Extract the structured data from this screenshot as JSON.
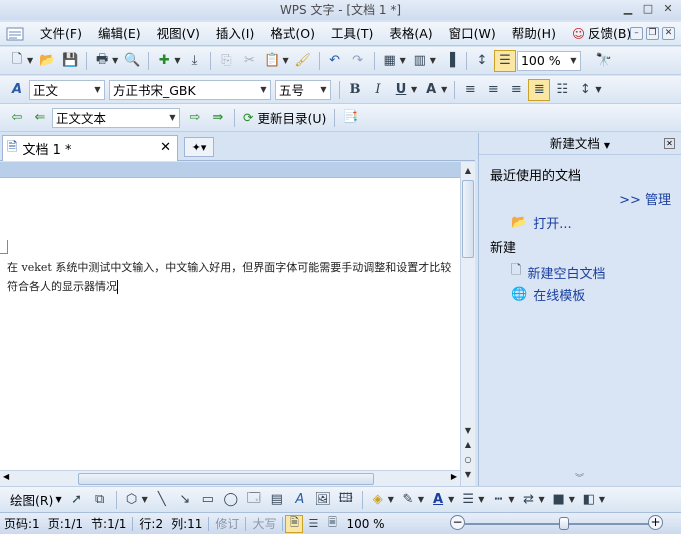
{
  "window": {
    "title": "WPS 文字 - [文档 1 *]"
  },
  "menubar": {
    "items": [
      "文件(F)",
      "编辑(E)",
      "视图(V)",
      "插入(I)",
      "格式(O)",
      "工具(T)",
      "表格(A)",
      "窗口(W)",
      "帮助(H)"
    ],
    "feedback": "反馈(B)"
  },
  "toolbar": {
    "zoom": "100 %"
  },
  "format_bar": {
    "style": "正文",
    "font": "方正书宋_GBK",
    "size": "五号"
  },
  "outline_bar": {
    "style": "正文文本",
    "update_toc": "更新目录(U)"
  },
  "tabs": {
    "doc": "文档 1 *"
  },
  "document": {
    "text": "在 veket 系统中测试中文输入，中文输入好用，但界面字体可能需要手动调整和设置才比较符合各人的显示器情况"
  },
  "taskpane": {
    "title": "新建文档",
    "recent_heading": "最近使用的文档",
    "manage": ">> 管理",
    "open": "打开...",
    "new_heading": "新建",
    "new_blank": "新建空白文档",
    "online_templates": "在线模板"
  },
  "drawbar": {
    "draw": "绘图(R)"
  },
  "status": {
    "page": "页码:1",
    "pages": "页:1/1",
    "section": "节:1/1",
    "row": "行:2",
    "col": "列:11",
    "revise": "修订",
    "caps": "大写",
    "zoom": "100 %",
    "zoom_level": 0.54
  },
  "colors": {
    "accent": "#1a3fa0",
    "font_color": "#1a3fa0"
  }
}
